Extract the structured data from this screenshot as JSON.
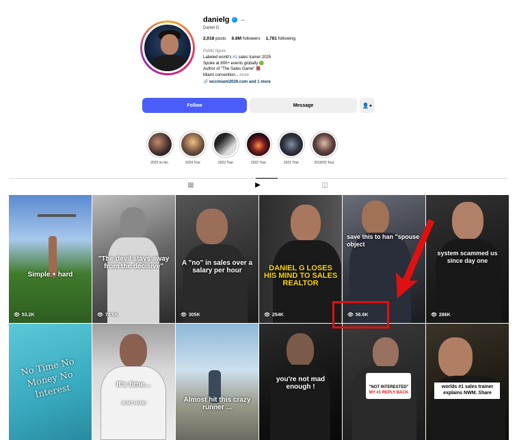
{
  "profile": {
    "username": "danielg",
    "fullname": "Daniel G",
    "posts": "2,018",
    "posts_label": "posts",
    "followers": "6.8M",
    "followers_label": "followers",
    "following": "1,781",
    "following_label": "following",
    "category": "Public figure",
    "bio": {
      "line1_pre": "Labeled world's ",
      "line1_hl": "#1",
      "line1_post": " sales trainer 2025",
      "line2": "Spoke at 800+ events globally 🟢",
      "line3": "Author of \"The Sales Game\" 📕",
      "line4": "Miami convention...",
      "more": "more"
    },
    "link": "wccmiami2026.com and 1 more"
  },
  "buttons": {
    "follow": "Follow",
    "message": "Message"
  },
  "highlights": [
    {
      "label": "2025 so far.."
    },
    {
      "label": "2024 Tour"
    },
    {
      "label": "2023 Tour"
    },
    {
      "label": "2022 Tour"
    },
    {
      "label": "2021 Tour"
    },
    {
      "label": "2019/20 Tour"
    }
  ],
  "posts": [
    {
      "caption": "Simple + hard",
      "views": "53.2K"
    },
    {
      "caption": "\"The devil stays away from the decisive\"",
      "views": "74.6K"
    },
    {
      "caption": "A \"no\" in sales over a salary per hour",
      "views": "305K"
    },
    {
      "caption": "DANIEL G LOSES HIS MIND TO SALES REALTOR",
      "views": "254K"
    },
    {
      "caption": "save this to han \"spouse object",
      "views": "56.6K"
    },
    {
      "caption": "system scammed us since day one",
      "views": "286K"
    },
    {
      "caption": "No Time No Money No Interest",
      "views": ""
    },
    {
      "caption": "It's time...",
      "sub": "IN MY HAND",
      "views": ""
    },
    {
      "caption": "Almost hit this crazy runner ...",
      "views": ""
    },
    {
      "caption": "you're not mad enough !",
      "views": ""
    },
    {
      "caption": "\"NOT INTERESTED\"",
      "sub": "MY #1 REPLY BACK",
      "views": ""
    },
    {
      "caption": "worlds #1 sales trainer explains NWM. Share",
      "views": ""
    }
  ],
  "colors": {
    "follow_bg": "#4a5cf9",
    "verified": "#0095f6",
    "annotation_red": "#e01010"
  }
}
